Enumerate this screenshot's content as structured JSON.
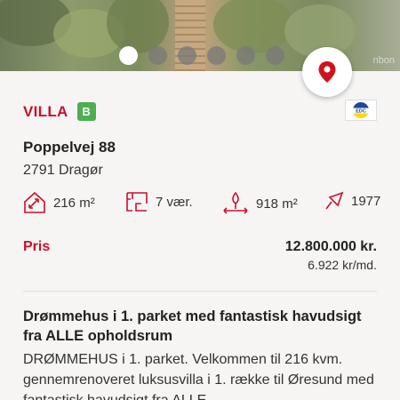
{
  "hero": {
    "watermark": "nbon",
    "slide_count": 6,
    "active_slide": 1
  },
  "map_button": {
    "icon": "map-pin-icon",
    "color": "#d0121d"
  },
  "listing": {
    "type": "VILLA",
    "energy_label": "B",
    "energy_color": "#4caf50",
    "agency_logo": "EDC",
    "address": "Poppelvej 88",
    "city": "2791 Dragør",
    "facts": {
      "area": "216 m²",
      "rooms": "7 vær.",
      "plot": "918 m²",
      "built": "1977"
    },
    "price_label": "Pris",
    "price": "12.800.000 kr.",
    "monthly": "6.922 kr/md.",
    "description_title": "Drømmehus i 1. parket med fantastisk havudsigt fra ALLE opholdsrum",
    "description_body": "DRØMMEHUS i 1. parket. Velkommen til 216 kvm. gennemrenoveret luksusvilla i 1. række til Øresund med fantastisk havudsigt fra ALLE"
  },
  "colors": {
    "accent": "#c8102e",
    "background": "#f6f5f4"
  }
}
